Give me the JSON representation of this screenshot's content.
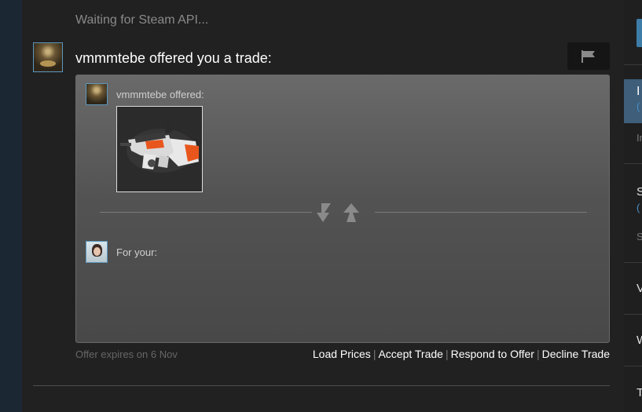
{
  "trade": {
    "status_text": "Waiting for Steam API...",
    "title": "vmmmtebe offered you a trade:",
    "them_label": "vmmmtebe offered:",
    "you_label": "For your:",
    "expires_text": "Offer expires on 6 Nov",
    "actions": {
      "load_prices": "Load Prices",
      "accept": "Accept Trade",
      "respond": "Respond to Offer",
      "decline": "Decline Trade"
    },
    "separator": "|"
  },
  "icons": {
    "flag": "flag-icon",
    "swap": "swap-arrows-icon",
    "item": "weapon-p90-icon"
  },
  "right_panel": {
    "tab_letter": "I",
    "tab_sub": "(",
    "row1": "In",
    "row2_letter": "S",
    "row2_sub": "(",
    "row2_dim": "S",
    "row3": "V",
    "row4": "W",
    "row5": "T"
  },
  "colors": {
    "accent_blue": "#5d98bd",
    "panel_bg": "#212121",
    "trade_box_top": "#6a6a6a",
    "item_accent": "#e8561c"
  }
}
